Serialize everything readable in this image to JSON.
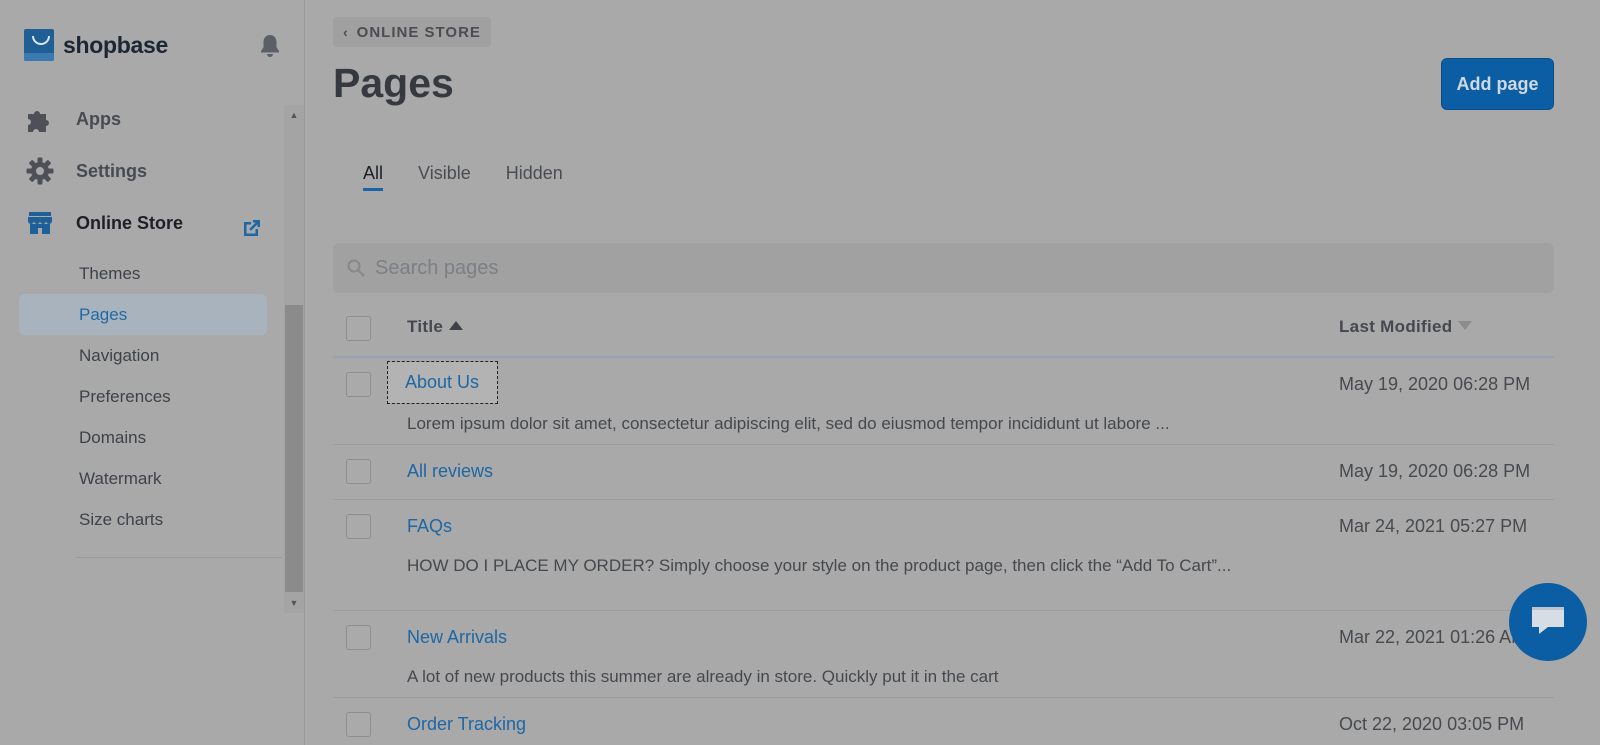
{
  "brand": {
    "name": "shopbase"
  },
  "sidebar": {
    "main_items": [
      {
        "label": "Apps",
        "icon": "puzzle-icon"
      },
      {
        "label": "Settings",
        "icon": "gear-icon"
      },
      {
        "label": "Online Store",
        "icon": "store-icon"
      }
    ],
    "sub_items": [
      {
        "label": "Themes"
      },
      {
        "label": "Pages"
      },
      {
        "label": "Navigation"
      },
      {
        "label": "Preferences"
      },
      {
        "label": "Domains"
      },
      {
        "label": "Watermark"
      },
      {
        "label": "Size charts"
      }
    ],
    "active_sub_item": "Pages"
  },
  "header": {
    "breadcrumb": "ONLINE STORE",
    "title": "Pages",
    "add_button": "Add page"
  },
  "tabs": [
    {
      "label": "All",
      "active": true
    },
    {
      "label": "Visible",
      "active": false
    },
    {
      "label": "Hidden",
      "active": false
    }
  ],
  "search": {
    "placeholder": "Search pages",
    "value": ""
  },
  "table": {
    "columns": {
      "title": "Title",
      "modified": "Last Modified"
    },
    "rows": [
      {
        "title": "About Us",
        "date": "May 19, 2020 06:28 PM",
        "desc": "Lorem ipsum dolor sit amet, consectetur adipiscing elit, sed do eiusmod tempor incididunt ut labore ..."
      },
      {
        "title": "All reviews",
        "date": "May 19, 2020 06:28 PM",
        "desc": ""
      },
      {
        "title": "FAQs",
        "date": "Mar 24, 2021 05:27 PM",
        "desc": "HOW DO I PLACE MY ORDER?  Simply choose your style on the product page, then click the “Add To Cart”..."
      },
      {
        "title": "New Arrivals",
        "date": "Mar 22, 2021 01:26 AM",
        "desc": "A lot of new products this summer are already in store. Quickly put it in the cart"
      },
      {
        "title": "Order Tracking",
        "date": "Oct 22, 2020 03:05 PM",
        "desc": ""
      }
    ]
  },
  "colors": {
    "accent": "#0b5ea3",
    "link": "#1d67a5",
    "overlay_bg": "#a9a9a9"
  }
}
